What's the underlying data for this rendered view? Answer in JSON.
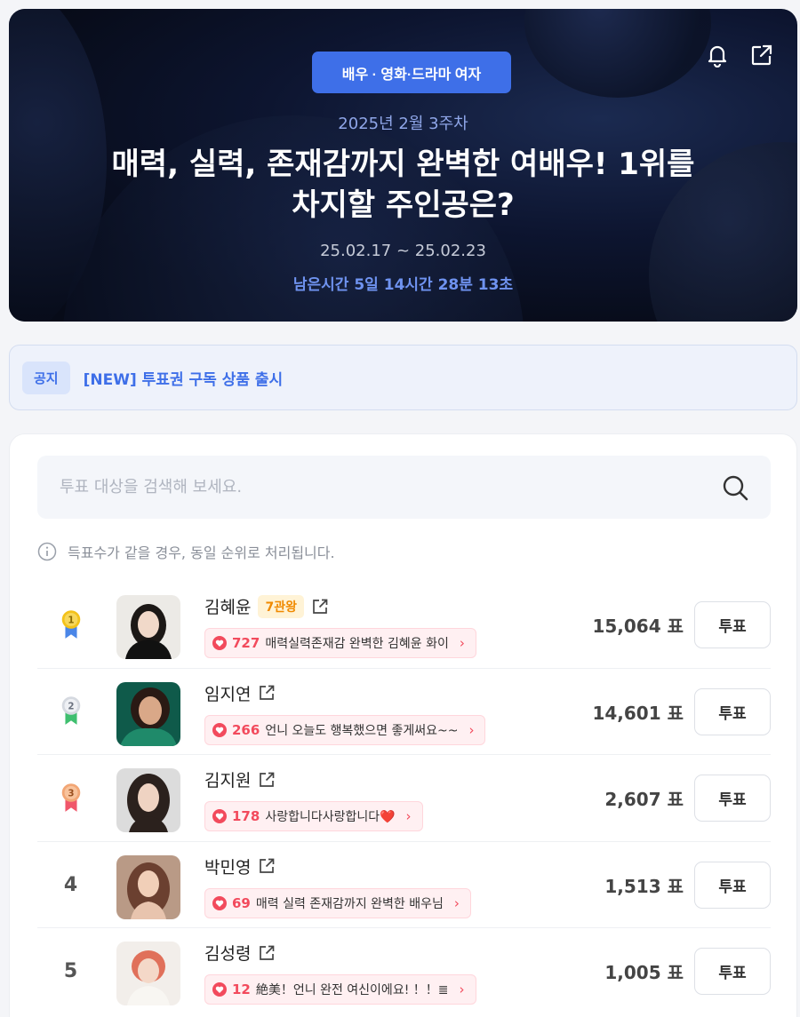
{
  "hero": {
    "category": "배우 · 영화·드라마 여자",
    "week": "2025년 2월 3주차",
    "title_line1": "매력, 실력, 존재감까지 완벽한 여배우! 1위를",
    "title_line2": "차지할 주인공은?",
    "dates": "25.02.17 ~ 25.02.23",
    "remaining": "남은시간 5일 14시간 28분 13초"
  },
  "notice": {
    "badge": "공지",
    "text": "[NEW] 투표권 구독 상품 출시"
  },
  "search": {
    "placeholder": "투표 대상을 검색해 보세요."
  },
  "info": {
    "text": "득표수가 같을 경우, 동일 순위로 처리됩니다."
  },
  "colors": {
    "accent": "#3e6fe8",
    "heart": "#f24a5c",
    "gold": "#f0b400",
    "silver": "#c7ccd6",
    "bronze": "#f0a070"
  },
  "rankings": [
    {
      "rank": "1",
      "medal": "gold",
      "name": "김혜윤",
      "badge": "7관왕",
      "comment_count": "727",
      "comment": "매력실력존재감 완벽한 김혜윤 화이",
      "votes": "15,064 표",
      "vote_label": "투표"
    },
    {
      "rank": "2",
      "medal": "silver",
      "name": "임지연",
      "badge": "",
      "comment_count": "266",
      "comment": "언니 오늘도 행복했으면 좋게써요~~",
      "votes": "14,601 표",
      "vote_label": "투표"
    },
    {
      "rank": "3",
      "medal": "bronze",
      "name": "김지원",
      "badge": "",
      "comment_count": "178",
      "comment": "사랑합니다사랑합니다❤️",
      "votes": "2,607 표",
      "vote_label": "투표"
    },
    {
      "rank": "4",
      "medal": "",
      "name": "박민영",
      "badge": "",
      "comment_count": "69",
      "comment": "매력 실력 존재감까지 완벽한 배우님",
      "votes": "1,513 표",
      "vote_label": "투표"
    },
    {
      "rank": "5",
      "medal": "",
      "name": "김성령",
      "badge": "",
      "comment_count": "12",
      "comment": "絶美！언니 완전 여신이에요! ！！≣",
      "votes": "1,005 표",
      "vote_label": "투표"
    }
  ]
}
